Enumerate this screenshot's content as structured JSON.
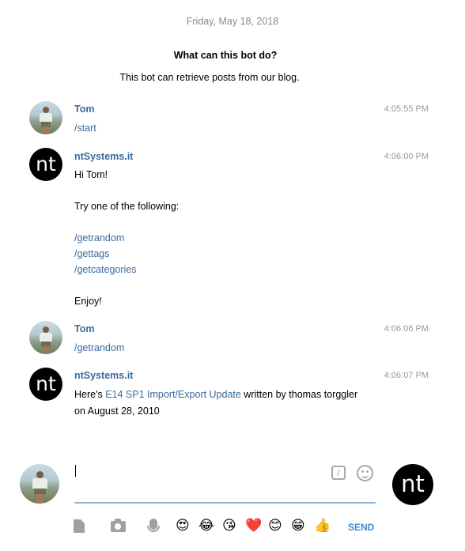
{
  "chat": {
    "date_separator": "Friday, May 18, 2018",
    "bot_info": {
      "title": "What can this bot do?",
      "description": "This bot can retrieve posts from our blog."
    },
    "messages": [
      {
        "sender": "Tom",
        "time": "4:05:55 PM",
        "lines": [
          "/start"
        ]
      },
      {
        "sender": "ntSystems.it",
        "avatar_text": "nt",
        "time": "4:06:00 PM",
        "lines": [
          "Hi Tom!",
          "Try one of the following:",
          "/getrandom",
          "/gettags",
          "/getcategories",
          "Enjoy!"
        ]
      },
      {
        "sender": "Tom",
        "time": "4:06:06 PM",
        "lines": [
          "/getrandom"
        ]
      },
      {
        "sender": "ntSystems.it",
        "avatar_text": "nt",
        "time": "4:06:07 PM",
        "text_before": "Here's ",
        "link": "E14 SP1 Import/Export Update",
        "text_after": " written by thomas torggler",
        "line2": "on August 28, 2010"
      }
    ]
  },
  "composer": {
    "input_value": "",
    "bot_avatar_text": "nt",
    "commands_icon": "slash",
    "emoji_icon": "smile-icon",
    "emojis": [
      "😍",
      "😂",
      "😘",
      "❤️",
      "😊",
      "😁",
      "👍"
    ],
    "send_label": "SEND"
  },
  "colors": {
    "link": "#3b6a9c",
    "send": "#3b8ad0",
    "input_underline": "#8cb5d9"
  }
}
